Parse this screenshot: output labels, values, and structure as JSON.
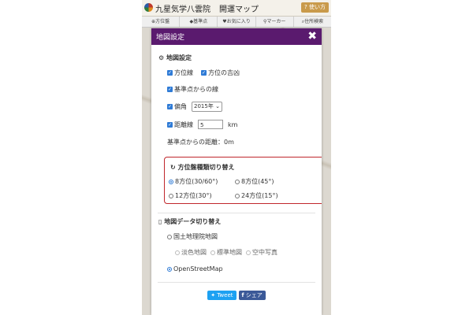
{
  "app": {
    "brand": "九星気学八雲院",
    "title": "開運マップ",
    "help_label": "使い方"
  },
  "nav": [
    {
      "icon": "compass-icon",
      "label": "方位盤"
    },
    {
      "icon": "pin-icon",
      "label": "基準点"
    },
    {
      "icon": "heart-icon",
      "label": "お気に入り"
    },
    {
      "icon": "marker-icon",
      "label": "マーカー"
    },
    {
      "icon": "search-icon",
      "label": "住所検索"
    }
  ],
  "modal": {
    "title": "地図設定",
    "close_symbol": "✖"
  },
  "map_settings": {
    "title": "地図設定",
    "direction_lines_label": "方位線",
    "direction_fortune_label": "方位の吉凶",
    "base_lines_label": "基準点からの線",
    "declination_label": "偏角",
    "declination_value": "2015年",
    "distance_lines_label": "距離線",
    "distance_value": "5",
    "distance_unit": "km",
    "distance_from_base": "基準点からの距離：0m"
  },
  "compass_type": {
    "title": "方位盤種類切り替え",
    "options": [
      {
        "label": "8方位(30/60°)",
        "selected": true
      },
      {
        "label": "8方位(45°)",
        "selected": false
      },
      {
        "label": "12方位(30°)",
        "selected": false
      },
      {
        "label": "24方位(15°)",
        "selected": false
      }
    ]
  },
  "map_data": {
    "title": "地図データ切り替え",
    "gsi_label": "国土地理院地図",
    "gsi_sub": [
      "淡色地図",
      "標準地図",
      "空中写真"
    ],
    "osm_label": "OpenStreetMap"
  },
  "share": {
    "tweet_label": "Tweet",
    "facebook_label": "シェア"
  },
  "colors": {
    "header_purple": "#5a1a6e",
    "highlight_red": "#c0262c",
    "checkbox_blue": "#2f7bd6",
    "twitter_blue": "#1da1f2",
    "facebook_blue": "#3b5998"
  }
}
